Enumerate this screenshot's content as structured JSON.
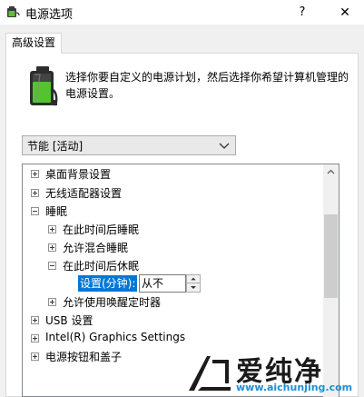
{
  "window": {
    "title": "电源选项",
    "help_label": "?",
    "close_label": "✕"
  },
  "tab": {
    "label": "高级设置"
  },
  "description": "选择你要自定义的电源计划，然后选择你希望计算机管理的电源设置。",
  "plan_select": {
    "value": "节能 [活动]"
  },
  "tree": {
    "items": [
      {
        "label": "桌面背景设置",
        "level": 0,
        "state": "collapsed"
      },
      {
        "label": "无线适配器设置",
        "level": 0,
        "state": "collapsed"
      },
      {
        "label": "睡眠",
        "level": 0,
        "state": "expanded"
      },
      {
        "label": "在此时间后睡眠",
        "level": 1,
        "state": "collapsed"
      },
      {
        "label": "允许混合睡眠",
        "level": 1,
        "state": "collapsed"
      },
      {
        "label": "在此时间后休眠",
        "level": 1,
        "state": "expanded"
      },
      {
        "label": "允许使用唤醒定时器",
        "level": 1,
        "state": "collapsed"
      },
      {
        "label": "USB 设置",
        "level": 0,
        "state": "collapsed"
      },
      {
        "label": "Intel(R) Graphics Settings",
        "level": 0,
        "state": "collapsed"
      },
      {
        "label": "电源按钮和盖子",
        "level": 0,
        "state": "collapsed"
      }
    ],
    "setting": {
      "label": "设置(分钟):",
      "value": "从不"
    }
  },
  "watermark": {
    "text": "爱纯净",
    "url": "www.aichunjing.com"
  },
  "colors": {
    "selection": "#0078d7",
    "watermark_url": "#1c8fd6"
  }
}
